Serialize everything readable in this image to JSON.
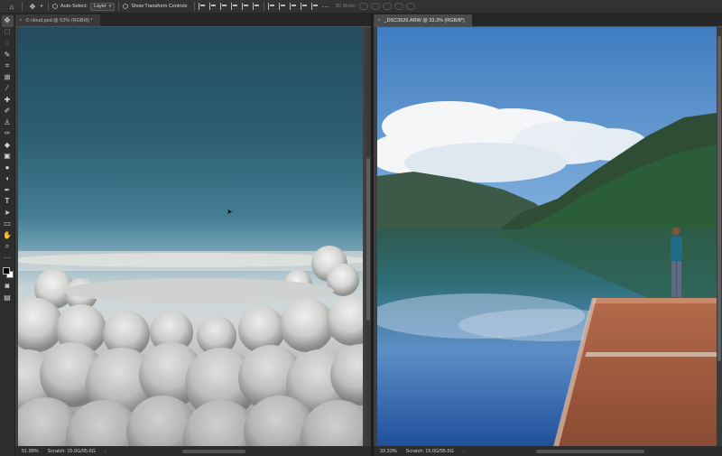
{
  "options_bar": {
    "auto_select_label": "Auto-Select:",
    "auto_select_target": "Layer",
    "show_transform_label": "Show Transform Controls",
    "mode_3d_label": "3D Mode:"
  },
  "toolbar": {
    "tools": [
      "move",
      "marquee",
      "lasso",
      "quick-select",
      "crop",
      "frame",
      "eyedropper",
      "healing",
      "brush",
      "clone-stamp",
      "history-brush",
      "eraser",
      "gradient",
      "blur",
      "dodge",
      "pen",
      "type",
      "path-select",
      "shape",
      "hand",
      "zoom",
      "more"
    ],
    "foreground_color": "#000000",
    "background_color": "#ffffff"
  },
  "documents": [
    {
      "tab_title": "© cloud.psd @ 52% (RGB/8) *",
      "zoom": "51.98%",
      "scratch": "Scratch: 15.0G/95.6G",
      "active": false
    },
    {
      "tab_title": "_DSC3526.ARW @ 33.3% (RGB/8*)",
      "zoom": "33.33%",
      "scratch": "Scratch: 15.0G/95.6G",
      "active": true
    }
  ],
  "colors": {
    "panel_bg": "#535353",
    "toolbar_bg": "#2d2d2d",
    "tab_active": "#4b4b4b"
  }
}
